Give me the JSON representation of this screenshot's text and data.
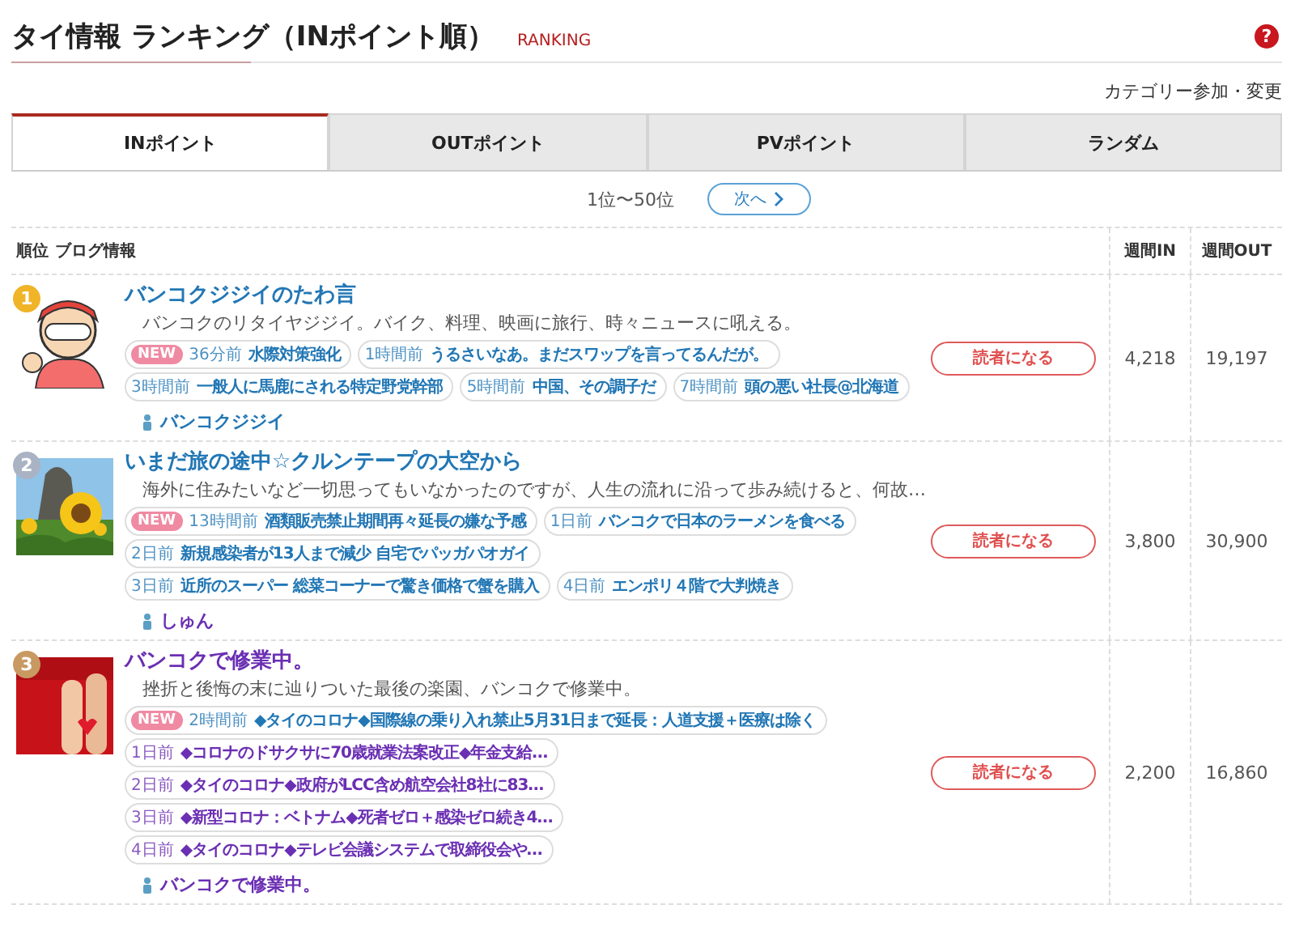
{
  "header": {
    "title": "タイ情報 ランキング（INポイント順）",
    "subtitle": "RANKING",
    "help": "?"
  },
  "category_link": "カテゴリー参加・変更",
  "tabs": [
    {
      "label": "INポイント",
      "selected": true
    },
    {
      "label": "OUTポイント",
      "selected": false
    },
    {
      "label": "PVポイント",
      "selected": false
    },
    {
      "label": "ランダム",
      "selected": false
    }
  ],
  "pager": {
    "range": "1位〜50位",
    "next": "次へ"
  },
  "table": {
    "columns": [
      "順位",
      "ブログ情報",
      "週間IN",
      "週間OUT"
    ],
    "rows": [
      {
        "rank": "1",
        "color": "#f0b429",
        "title": "バンコクジジイのたわ言",
        "title_visited": false,
        "description": "バンコクのリタイヤジジイ。バイク、料理、映画に旅行、時々ニュースに吼える。",
        "tags": [
          {
            "badge": "NEW",
            "age": "36分前",
            "text": "水際対策強化",
            "visited": false
          },
          {
            "age": "1時間前",
            "text": "うるさいなあ。まだスワップを言ってるんだが。",
            "visited": false
          },
          {
            "age": "3時間前",
            "text": "一般人に馬鹿にされる特定野党幹部",
            "visited": false
          },
          {
            "age": "5時間前",
            "text": "中国、その調子だ",
            "visited": false
          },
          {
            "age": "7時間前",
            "text": "頭の悪い社長@北海道",
            "visited": false
          }
        ],
        "author": "バンコクジジイ",
        "author_visited": false,
        "button": "読者になる",
        "weekly_in": "4,218",
        "weekly_out": "19,197"
      },
      {
        "rank": "2",
        "color": "#a9b3c4",
        "title": "いまだ旅の途中☆クルンテープの大空から",
        "title_visited": false,
        "description": "海外に住みたいなど一切思ってもいなかったのですが、人生の流れに沿って歩み続けると、何故…",
        "tags": [
          {
            "badge": "NEW",
            "age": "13時間前",
            "text": "酒類販売禁止期間再々延長の嫌な予感",
            "visited": false
          },
          {
            "age": "1日前",
            "text": "バンコクで日本のラーメンを食べる",
            "visited": false
          },
          {
            "age": "2日前",
            "text": "新規感染者が13人まで減少 自宅でパッガパオガイ",
            "visited": false
          },
          {
            "age": "3日前",
            "text": "近所のスーパー 総菜コーナーで驚き価格で蟹を購入",
            "visited": false
          },
          {
            "age": "4日前",
            "text": "エンポリ４階で大判焼き",
            "visited": false
          }
        ],
        "author": "しゅん",
        "author_visited": true,
        "button": "読者になる",
        "weekly_in": "3,800",
        "weekly_out": "30,900"
      },
      {
        "rank": "3",
        "color": "#c89a62",
        "title": "バンコクで修業中。",
        "title_visited": true,
        "description": "挫折と後悔の末に辿りついた最後の楽園、バンコクで修業中。",
        "tags": [
          {
            "badge": "NEW",
            "age": "2時間前",
            "text": "◆タイのコロナ◆国際線の乗り入れ禁止5月31日まで延長：人道支援＋医療は除く",
            "visited": false
          },
          {
            "age": "1日前",
            "text": "◆コロナのドサクサに70歳就業法案改正◆年金支給…",
            "visited": true
          },
          {
            "age": "2日前",
            "text": "◆タイのコロナ◆政府がLCC含め航空会社8社に83…",
            "visited": true
          },
          {
            "age": "3日前",
            "text": "◆新型コロナ：ベトナム◆死者ゼロ＋感染ゼロ続き4…",
            "visited": true
          },
          {
            "age": "4日前",
            "text": "◆タイのコロナ◆テレビ会議システムで取締役会や…",
            "visited": true
          }
        ],
        "author": "バンコクで修業中。",
        "author_visited": true,
        "button": "読者になる",
        "weekly_in": "2,200",
        "weekly_out": "16,860"
      }
    ]
  }
}
